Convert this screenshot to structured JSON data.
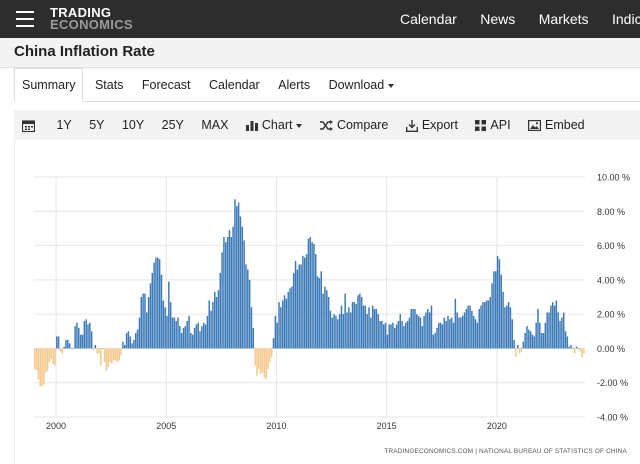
{
  "header": {
    "logo_line1": "TRADING",
    "logo_line2": "ECONOMICS",
    "nav": [
      "Calendar",
      "News",
      "Markets",
      "Indica"
    ]
  },
  "page_title": "China Inflation Rate",
  "tabs": [
    {
      "label": "Summary",
      "active": true
    },
    {
      "label": "Stats"
    },
    {
      "label": "Forecast"
    },
    {
      "label": "Calendar"
    },
    {
      "label": "Alerts"
    },
    {
      "label": "Download"
    }
  ],
  "toolbar": {
    "calendar_icon": "calendar-icon",
    "ranges": [
      "1Y",
      "5Y",
      "10Y",
      "25Y",
      "MAX"
    ],
    "chart_label": "Chart",
    "compare_label": "Compare",
    "export_label": "Export",
    "api_label": "API",
    "embed_label": "Embed"
  },
  "colors": {
    "positive": "#3d7ab8",
    "negative": "#f5c88c",
    "topbar": "#2d2d2d"
  },
  "chart_data": {
    "type": "bar",
    "x_start": "1999-01",
    "x_end": "2023-12",
    "frequency": "monthly",
    "ylim": [
      -4,
      10
    ],
    "yticks": [
      "10.00 %",
      "8.00 %",
      "6.00 %",
      "4.00 %",
      "2.00 %",
      "0.00 %",
      "-2.00 %",
      "-4.00 %"
    ],
    "ytick_values": [
      10,
      8,
      6,
      4,
      2,
      0,
      -2,
      -4
    ],
    "xticks": [
      "2000",
      "2005",
      "2010",
      "2015",
      "2020"
    ],
    "xtick_years": [
      2000,
      2005,
      2010,
      2015,
      2020
    ],
    "grid": true,
    "source": "TRADINGECONOMICS.COM | NATIONAL BUREAU OF STATISTICS OF CHINA",
    "values": [
      -1.2,
      -1.3,
      -1.8,
      -2.2,
      -2.2,
      -2.1,
      -1.4,
      -1.3,
      -0.8,
      -0.6,
      -0.9,
      -1.0,
      0.7,
      0.7,
      -0.2,
      -0.3,
      0.1,
      0.5,
      0.5,
      0.3,
      0.0,
      0.0,
      1.3,
      1.5,
      1.2,
      0.8,
      0.8,
      1.6,
      1.7,
      1.4,
      1.5,
      1.0,
      -0.1,
      0.2,
      -0.3,
      -0.3,
      -1.0,
      0.0,
      -0.8,
      -1.3,
      -1.1,
      -0.8,
      -0.9,
      -0.7,
      -0.7,
      -0.8,
      -0.7,
      -0.4,
      0.4,
      0.2,
      0.9,
      1.0,
      0.7,
      0.3,
      0.5,
      0.9,
      1.1,
      1.8,
      3.0,
      3.2,
      3.2,
      2.1,
      3.0,
      3.8,
      4.4,
      5.0,
      5.3,
      5.3,
      5.2,
      4.3,
      2.8,
      2.4,
      1.9,
      3.9,
      2.7,
      1.8,
      1.8,
      1.6,
      1.8,
      1.3,
      0.9,
      1.2,
      1.3,
      1.6,
      1.9,
      0.9,
      0.8,
      1.2,
      1.4,
      1.5,
      1.0,
      1.3,
      1.5,
      1.4,
      1.9,
      2.8,
      2.2,
      2.7,
      3.3,
      3.0,
      3.4,
      4.4,
      5.6,
      6.5,
      6.2,
      6.5,
      6.9,
      6.5,
      7.1,
      8.7,
      8.3,
      8.5,
      7.7,
      7.1,
      6.3,
      4.9,
      4.6,
      4.0,
      2.4,
      1.2,
      -1.0,
      -1.6,
      -1.2,
      -1.5,
      -1.4,
      -1.7,
      -1.8,
      -1.2,
      -0.8,
      -0.5,
      0.6,
      1.9,
      1.5,
      2.7,
      2.4,
      2.8,
      3.1,
      2.9,
      3.3,
      3.5,
      3.6,
      4.4,
      5.1,
      4.6,
      4.9,
      4.9,
      5.4,
      5.3,
      5.5,
      6.4,
      6.5,
      6.2,
      6.1,
      5.5,
      4.2,
      4.1,
      4.5,
      3.2,
      3.6,
      3.4,
      3.0,
      2.2,
      1.8,
      2.0,
      1.9,
      1.7,
      2.0,
      2.5,
      2.0,
      3.2,
      2.1,
      2.4,
      2.1,
      2.7,
      2.7,
      2.6,
      3.1,
      3.2,
      3.0,
      2.5,
      2.5,
      2.0,
      2.4,
      1.8,
      2.5,
      2.3,
      2.3,
      2.0,
      1.6,
      1.6,
      1.4,
      1.5,
      0.8,
      1.4,
      1.4,
      1.5,
      1.2,
      1.4,
      1.6,
      2.0,
      1.6,
      1.3,
      1.5,
      1.6,
      1.8,
      2.3,
      2.3,
      2.3,
      2.0,
      1.9,
      1.8,
      1.3,
      1.9,
      2.1,
      2.3,
      2.1,
      2.5,
      0.8,
      0.9,
      1.2,
      1.5,
      1.5,
      1.4,
      1.8,
      1.6,
      1.9,
      1.7,
      1.8,
      1.5,
      2.9,
      2.1,
      1.8,
      1.8,
      1.9,
      2.1,
      2.3,
      2.5,
      2.5,
      2.2,
      1.9,
      1.7,
      1.5,
      2.3,
      2.5,
      2.7,
      2.7,
      2.8,
      2.8,
      3.0,
      3.8,
      4.5,
      4.5,
      5.4,
      5.2,
      4.3,
      3.3,
      2.4,
      2.5,
      2.7,
      2.4,
      1.7,
      0.5,
      -0.5,
      0.2,
      -0.3,
      -0.2,
      0.4,
      0.9,
      1.3,
      1.1,
      1.0,
      0.8,
      0.7,
      1.5,
      2.3,
      1.5,
      0.9,
      0.9,
      1.5,
      2.1,
      2.1,
      2.5,
      2.7,
      2.5,
      2.8,
      2.1,
      1.6,
      1.8,
      2.1,
      1.0,
      0.7,
      0.1,
      0.2,
      0.0,
      -0.3,
      0.1,
      0.0,
      -0.2,
      -0.5,
      -0.3
    ]
  }
}
